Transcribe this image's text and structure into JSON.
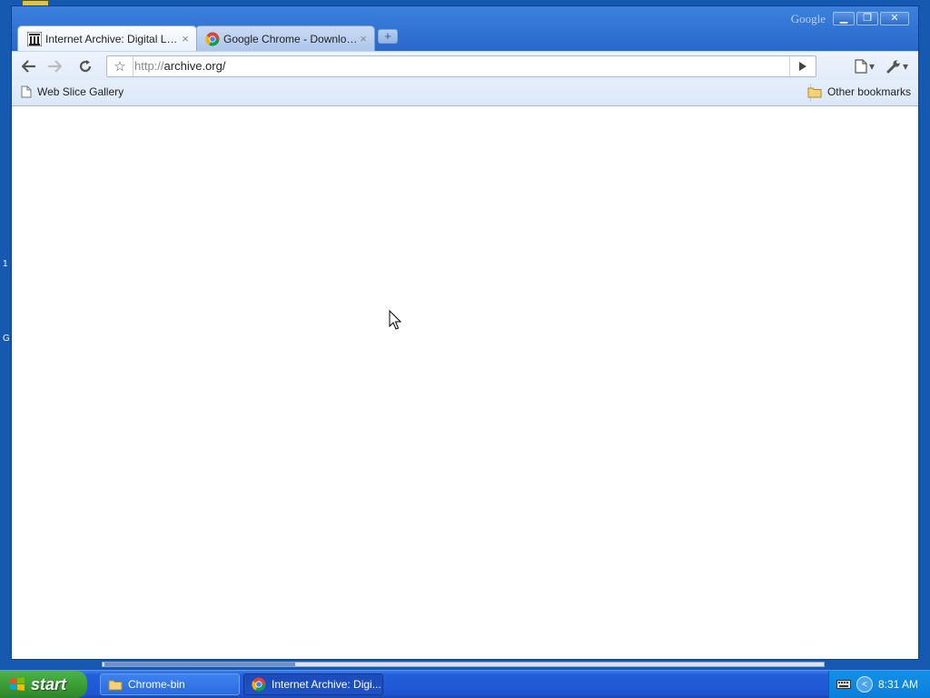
{
  "window": {
    "brand": "Google",
    "min_glyph": "▁",
    "max_glyph": "❐",
    "close_glyph": "✕"
  },
  "tabs": [
    {
      "title": "Internet Archive: Digital Lib...",
      "favicon": "archive-icon"
    },
    {
      "title": "Google Chrome - Download...",
      "favicon": "chrome-icon"
    }
  ],
  "toolbar": {
    "url_scheme": "http://",
    "url_host": "archive.org/"
  },
  "bookmarks": {
    "left": "Web Slice Gallery",
    "right": "Other bookmarks"
  },
  "desktop": {
    "num1": "1",
    "num2": "G"
  },
  "taskbar": {
    "start_label": "start",
    "items": [
      {
        "label": "Chrome-bin",
        "icon": "folder-icon"
      },
      {
        "label": "Internet Archive: Digi...",
        "icon": "chrome-icon"
      }
    ],
    "clock": "8:31 AM"
  }
}
